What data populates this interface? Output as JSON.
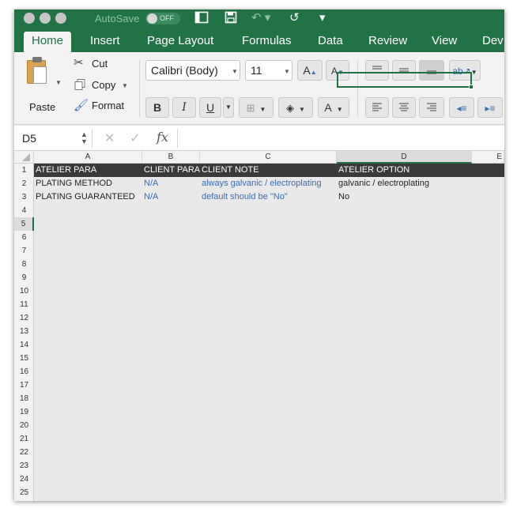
{
  "titlebar": {
    "autosave_label": "AutoSave",
    "autosave_state": "OFF",
    "redo_icon": "↺",
    "more_icon": "▾"
  },
  "tabs": [
    "Home",
    "Insert",
    "Page Layout",
    "Formulas",
    "Data",
    "Review",
    "View",
    "Dev"
  ],
  "active_tab": "Home",
  "clipboard": {
    "paste_label": "Paste",
    "cut_label": "Cut",
    "copy_label": "Copy",
    "format_label": "Format"
  },
  "font": {
    "family": "Calibri (Body)",
    "size": "11",
    "bold": "B",
    "italic": "I",
    "underline": "U",
    "grow": "A",
    "shrink": "A",
    "color": "A"
  },
  "formula_bar": {
    "name_box": "D5",
    "cancel": "✕",
    "confirm": "✓",
    "fx": "fx",
    "content": ""
  },
  "grid": {
    "columns": [
      "A",
      "B",
      "C",
      "D",
      "E"
    ],
    "selected_column": "D",
    "selected_row": 5,
    "rows": [
      "1",
      "2",
      "3",
      "4",
      "5",
      "6",
      "7",
      "8",
      "9",
      "10",
      "11",
      "12",
      "13",
      "14",
      "15",
      "16",
      "17",
      "18",
      "19",
      "20",
      "21",
      "22",
      "23",
      "24",
      "25"
    ],
    "header_row": [
      "ATELIER PARA",
      "CLIENT PARA",
      "CLIENT NOTE",
      "ATELIER OPTION"
    ],
    "data_rows": [
      [
        "PLATING METHOD",
        "N/A",
        "always galvanic / electroplating",
        "galvanic / electroplating"
      ],
      [
        "PLATING GUARANTEED",
        "N/A",
        "default should be \"No\"",
        "No"
      ]
    ]
  },
  "colors": {
    "brand_green": "#217346",
    "header_fill": "#3a3a3a",
    "note_blue": "#3b6db5"
  }
}
